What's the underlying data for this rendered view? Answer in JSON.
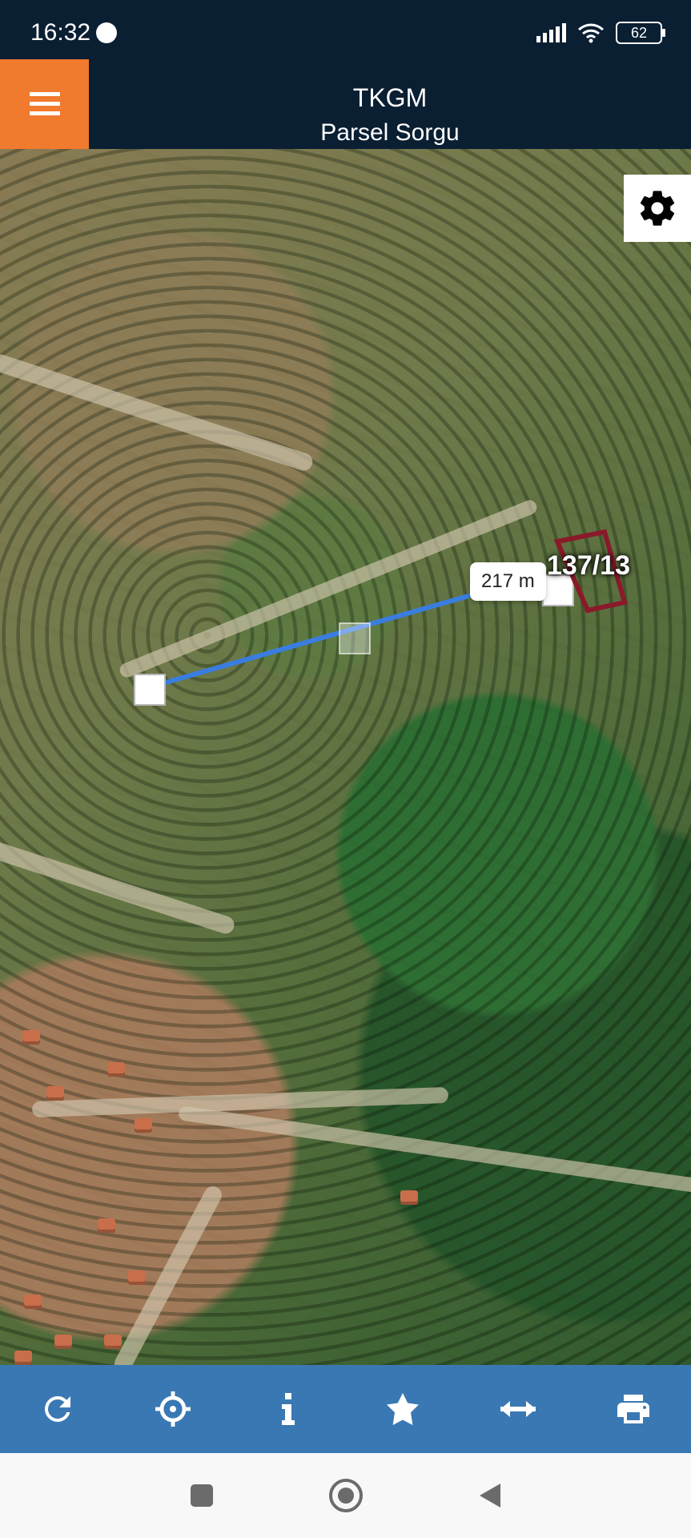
{
  "status_bar": {
    "time": "16:32",
    "battery": "62"
  },
  "app_bar": {
    "title": "TKGM",
    "subtitle": "Parsel Sorgu"
  },
  "map": {
    "distance_label": "217 m",
    "parcel_label": "137/13"
  },
  "toolbar": {
    "buttons": [
      {
        "icon": "refresh-icon"
      },
      {
        "icon": "crosshair-icon"
      },
      {
        "icon": "info-icon"
      },
      {
        "icon": "star-icon"
      },
      {
        "icon": "measure-icon"
      },
      {
        "icon": "print-icon"
      }
    ]
  },
  "colors": {
    "app_bar": "#0b1f33",
    "menu_button": "#f07a2e",
    "toolbar": "#3a78b4",
    "measure_line": "#3a7de0",
    "parcel_outline": "#8a1a2a"
  }
}
